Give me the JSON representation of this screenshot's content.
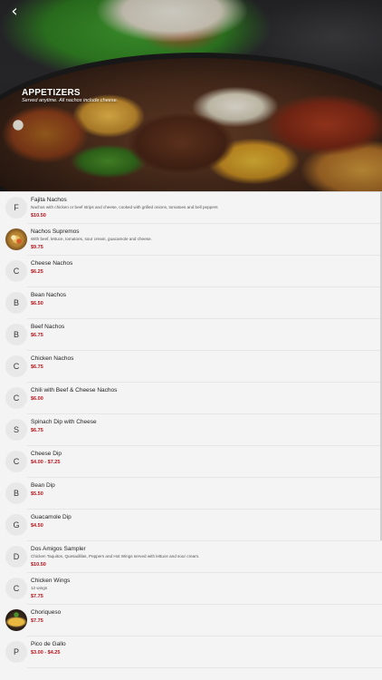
{
  "header": {
    "title": "APPETIZERS",
    "subtitle": "Served anytime. All nachos include cheese.",
    "back_icon": "chevron-left-icon"
  },
  "colors": {
    "price": "#b4131b",
    "avatar_bg": "#e8e8e8",
    "background": "#f4f4f4"
  },
  "items": [
    {
      "initial": "F",
      "name": "Fajita Nachos",
      "desc": "Nachos with chicken or beef strips and cheese, cooked with grilled onions, tomatoes and bell peppers",
      "price": "$10.50"
    },
    {
      "initial": "",
      "name": "Nachos Supremos",
      "desc": "With beef, lettuce, tomatoes, sour cream, guacamole and cheese.",
      "price": "$9.75"
    },
    {
      "initial": "C",
      "name": "Cheese Nachos",
      "desc": "",
      "price": "$6.25"
    },
    {
      "initial": "B",
      "name": "Bean Nachos",
      "desc": "",
      "price": "$6.50"
    },
    {
      "initial": "B",
      "name": "Beef Nachos",
      "desc": "",
      "price": "$6.75"
    },
    {
      "initial": "C",
      "name": "Chicken Nachos",
      "desc": "",
      "price": "$6.75"
    },
    {
      "initial": "C",
      "name": "Chili with Beef & Cheese Nachos",
      "desc": "",
      "price": "$6.00"
    },
    {
      "initial": "S",
      "name": "Spinach Dip with Cheese",
      "desc": "",
      "price": "$6.75"
    },
    {
      "initial": "C",
      "name": "Cheese Dip",
      "desc": "",
      "price": "$4.00 - $7.25"
    },
    {
      "initial": "B",
      "name": "Bean Dip",
      "desc": "",
      "price": "$5.50"
    },
    {
      "initial": "G",
      "name": "Guacamole Dip",
      "desc": "",
      "price": "$4.50"
    },
    {
      "initial": "D",
      "name": "Dos Amigos Sampler",
      "desc": "Chicken Taquitos, Quesadillas, Peppers and Hot Wings served with lettuce and sour cream.",
      "price": "$10.50"
    },
    {
      "initial": "C",
      "name": "Chicken Wings",
      "desc": "12 wings",
      "price": "$7.75"
    },
    {
      "initial": "",
      "name": "Choriqueso",
      "desc": "",
      "price": "$7.75"
    },
    {
      "initial": "P",
      "name": "Pico de Gallo",
      "desc": "",
      "price": "$3.00 - $4.25"
    }
  ]
}
